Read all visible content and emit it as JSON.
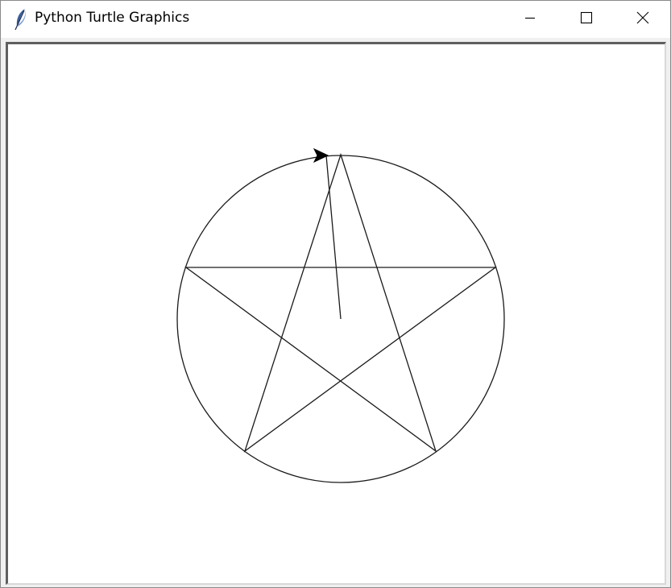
{
  "window": {
    "title": "Python Turtle Graphics",
    "icon": "feather-icon"
  },
  "title_buttons": {
    "minimize": "minimize-icon",
    "maximize": "maximize-icon",
    "close": "close-icon"
  },
  "drawing": {
    "stroke_color": "#000000",
    "turtle_shape": "arrow",
    "shapes": [
      "circle",
      "pentagram",
      "line"
    ]
  }
}
